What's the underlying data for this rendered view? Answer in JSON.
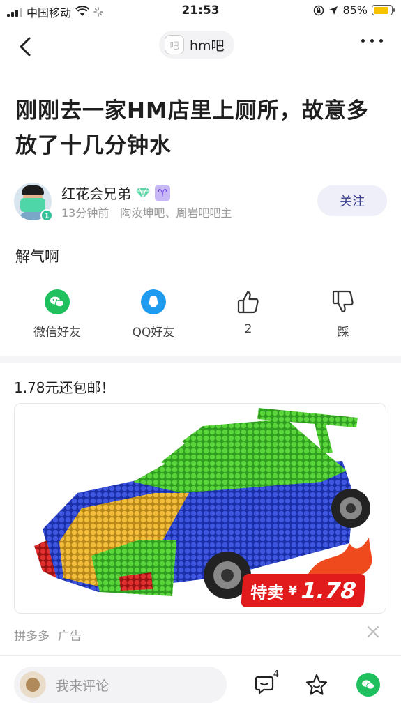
{
  "status_bar": {
    "carrier": "中国移动",
    "time": "21:53",
    "battery": "85%",
    "battery_level": 0.85
  },
  "nav": {
    "forum_name": "hm吧",
    "forum_logo_text": "吧"
  },
  "post": {
    "title": "刚刚去一家HM店里上厕所，故意多放了十几分钟水",
    "author": {
      "name": "红花会兄弟",
      "level": "1",
      "time": "13分钟前",
      "roles": "陶汝坤吧、周岩吧吧主"
    },
    "follow_label": "关注",
    "content": "解气啊"
  },
  "actions": {
    "wechat_label": "微信好友",
    "qq_label": "QQ好友",
    "like_count": "2",
    "dislike_label": "踩"
  },
  "ad": {
    "title": "1.78元还包邮！",
    "tag_text": "特卖",
    "tag_currency": "¥",
    "tag_price": "1.78",
    "source": "拼多多",
    "ad_label": "广告"
  },
  "bottom": {
    "comment_placeholder": "我来评论",
    "comment_count": "4"
  },
  "colors": {
    "accent_green": "#1fc05d",
    "qq_blue": "#1d9bf0",
    "price_red": "#e11b1b",
    "follow_text": "#3b3f8f"
  }
}
